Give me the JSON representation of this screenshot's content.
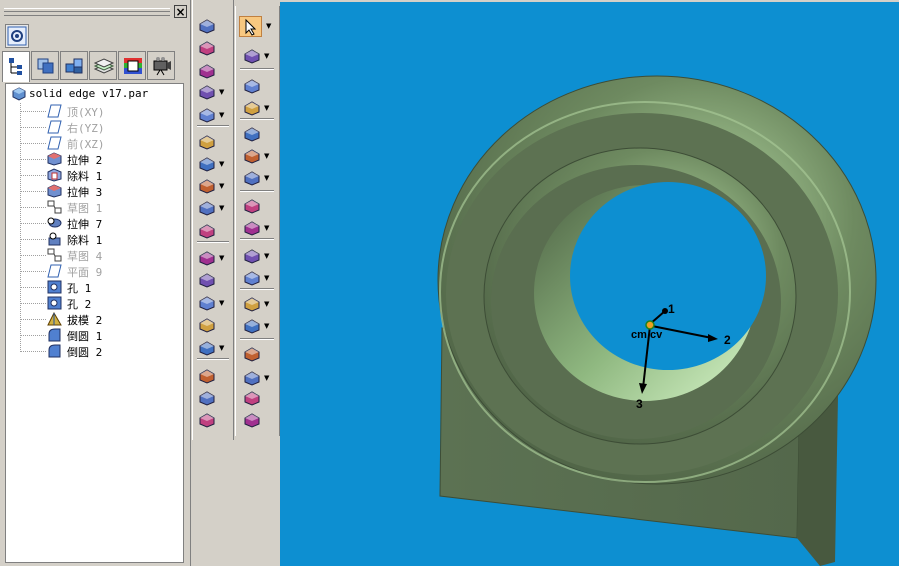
{
  "pathfinder": {
    "close_label": "×",
    "tabs": [
      "feature-tree-icon",
      "layers-icon",
      "assembly-icon",
      "sheets-icon",
      "material-icon",
      "camera-icon"
    ],
    "root": "solid edge v17.par",
    "items": [
      {
        "label": "顶(XY)",
        "icon": "plane-icon",
        "dim": true
      },
      {
        "label": "右(YZ)",
        "icon": "plane-icon",
        "dim": true
      },
      {
        "label": "前(XZ)",
        "icon": "plane-icon",
        "dim": true
      },
      {
        "label": "拉伸 2",
        "icon": "protrusion-icon",
        "dim": false
      },
      {
        "label": "除料 1",
        "icon": "cutout-icon",
        "dim": false
      },
      {
        "label": "拉伸 3",
        "icon": "protrusion-icon",
        "dim": false
      },
      {
        "label": "草图 1",
        "icon": "sketch-icon",
        "dim": true
      },
      {
        "label": "拉伸 7",
        "icon": "revolve-icon",
        "dim": false
      },
      {
        "label": "除料 1",
        "icon": "revolved-cutout-icon",
        "dim": false
      },
      {
        "label": "草图 4",
        "icon": "sketch-icon",
        "dim": true
      },
      {
        "label": "平面 9",
        "icon": "plane-icon",
        "dim": true
      },
      {
        "label": "孔 1",
        "icon": "hole-icon",
        "dim": false
      },
      {
        "label": "孔 2",
        "icon": "hole-icon",
        "dim": false
      },
      {
        "label": "拔模 2",
        "icon": "draft-icon",
        "dim": false
      },
      {
        "label": "倒圆 1",
        "icon": "round-icon",
        "dim": false
      },
      {
        "label": "倒圆 2",
        "icon": "round-icon",
        "dim": false
      }
    ]
  },
  "viewport": {
    "cm_label": "cm cv",
    "axes": [
      "1",
      "2",
      "3"
    ],
    "background_color": "#0d8fd1",
    "model_color": "#5c7052"
  }
}
